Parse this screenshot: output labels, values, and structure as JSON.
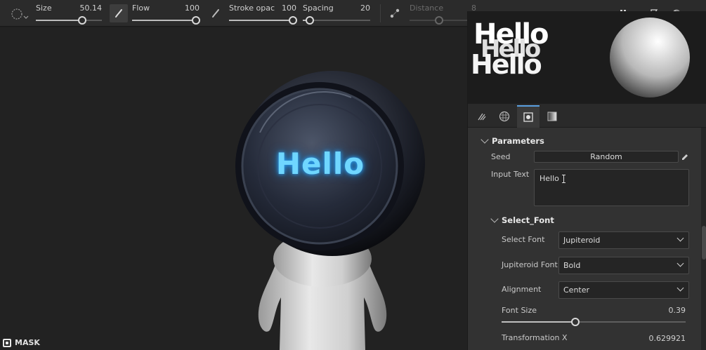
{
  "toolbar": {
    "sliders": [
      {
        "label": "Size",
        "value": "50.14",
        "level": 0.66
      },
      {
        "label": "Flow",
        "value": "100",
        "level": 1.0
      },
      {
        "label": "Stroke opac",
        "value": "100",
        "level": 1.0
      },
      {
        "label": "Spacing",
        "value": "20",
        "level": 0.05
      },
      {
        "label": "Distance",
        "value": "8",
        "level": 0.45
      }
    ]
  },
  "preview": {
    "text_sample": "Hello"
  },
  "viewport": {
    "model_text": "Hello",
    "mask_label": "MASK"
  },
  "panel": {
    "tabs": [
      "brush-tab",
      "material-tab",
      "mask-tab",
      "gradient-tab"
    ],
    "active_tab": 2,
    "parameters": {
      "title": "Parameters",
      "seed_label": "Seed",
      "seed_button": "Random",
      "input_text_label": "Input Text",
      "input_text_value": "Hello"
    },
    "select_font": {
      "title": "Select_Font",
      "font_label": "Select Font",
      "font_value": "Jupiteroid",
      "style_label": "Jupiteroid Font",
      "style_value": "Bold",
      "alignment_label": "Alignment",
      "alignment_value": "Center",
      "font_size_label": "Font Size",
      "font_size_value": "0.39",
      "font_size_level": 0.39,
      "transform_x_label": "Transformation X",
      "transform_x_value": "0.629921"
    }
  },
  "colors": {
    "accent": "#5a9fe0",
    "glow_text": "#6fd6ff",
    "bg": "#1e1e1e"
  }
}
